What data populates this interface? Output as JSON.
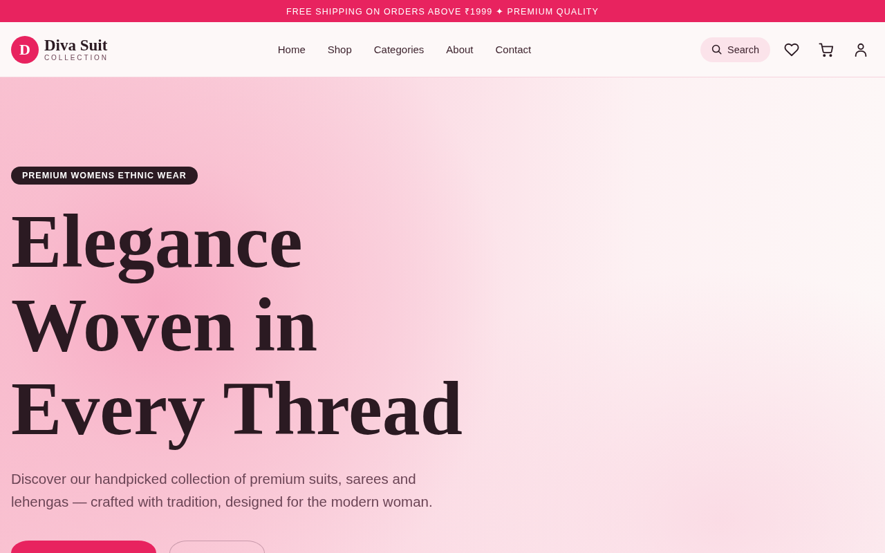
{
  "announcement": "FREE SHIPPING ON ORDERS ABOVE ₹1999 ✦ PREMIUM QUALITY",
  "header": {
    "logo": {
      "mark": "D",
      "name": "Diva Suit",
      "tagline": "COLLECTION"
    },
    "nav": [
      "Home",
      "Shop",
      "Categories",
      "About",
      "Contact"
    ],
    "search": {
      "label": "Search"
    },
    "actions": [
      {
        "kind": "heart"
      },
      {
        "kind": "cart"
      },
      {
        "kind": "user"
      }
    ]
  },
  "hero": {
    "badge": "PREMIUM WOMENS ETHNIC WEAR",
    "headline": "Elegance Woven in Every Thread",
    "description": "Discover our handpicked collection of premium suits, sarees and lehengas — crafted with tradition, designed for the modern woman.",
    "buttons": [
      {
        "kind": "filled"
      },
      {
        "kind": "outline"
      }
    ]
  }
}
